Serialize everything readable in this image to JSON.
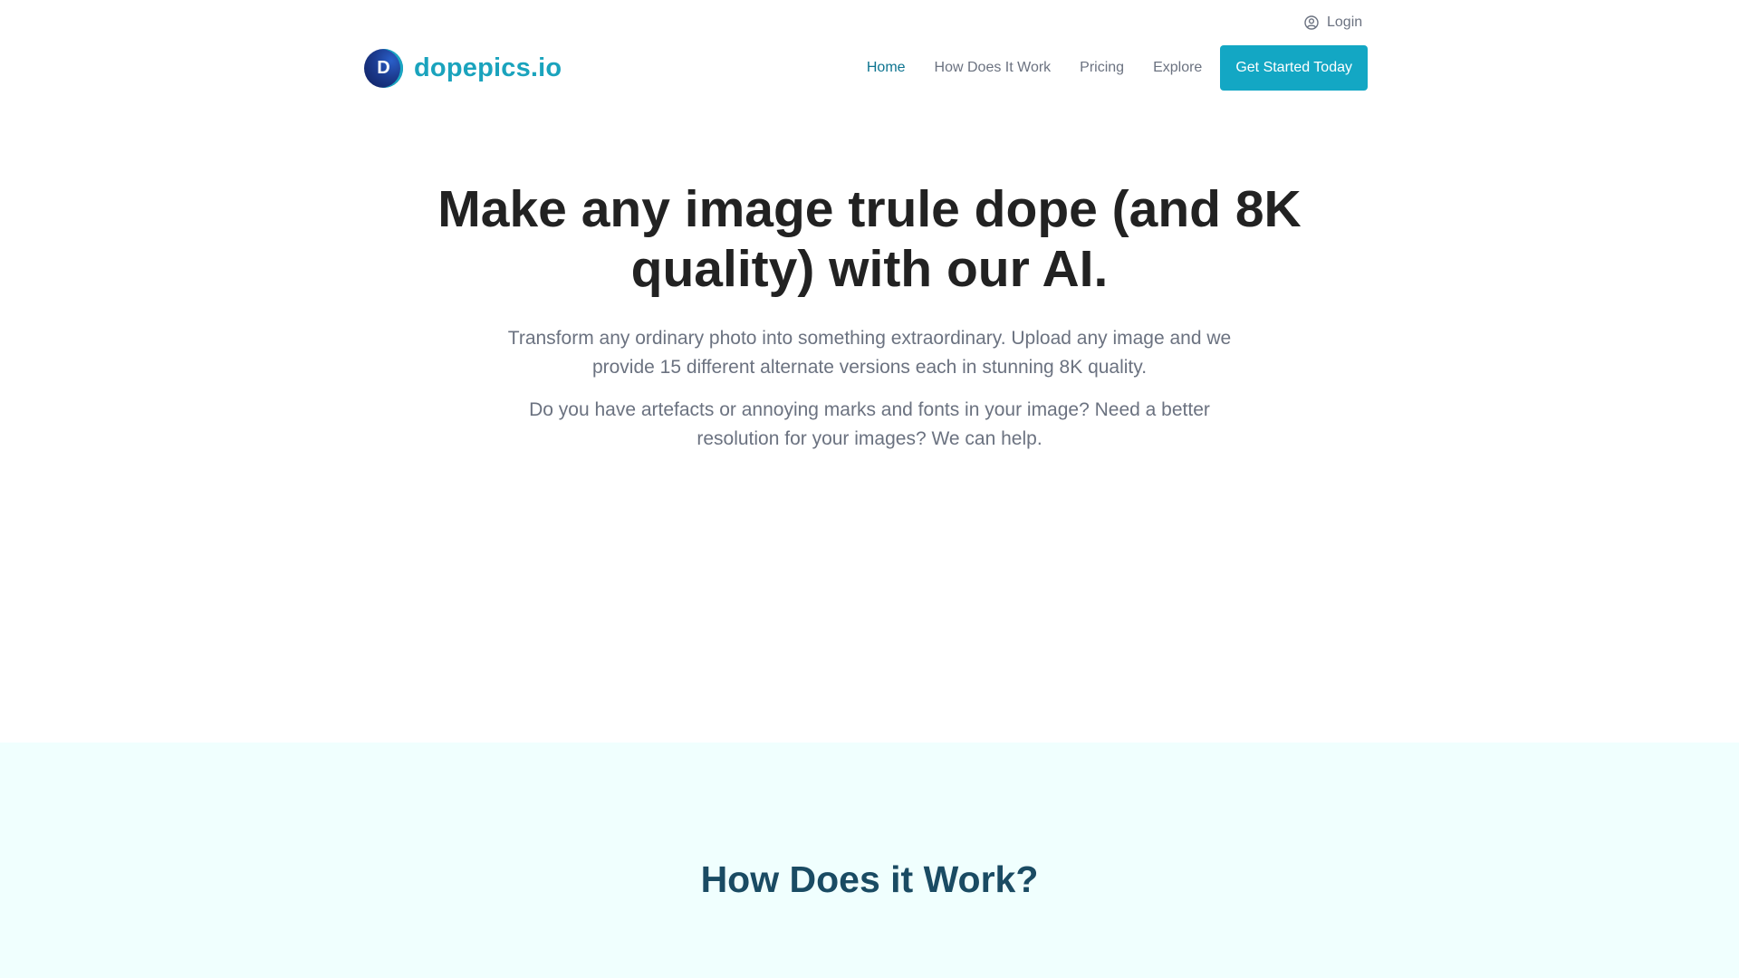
{
  "top_bar": {
    "login_label": "Login",
    "login_icon": "user-circle-icon"
  },
  "header": {
    "logo_letter": "D",
    "brand_name": "dopepics.io",
    "nav": {
      "home": "Home",
      "how": "How Does It Work",
      "pricing": "Pricing",
      "explore": "Explore",
      "cta": "Get Started Today"
    }
  },
  "hero": {
    "title": "Make any image trule dope (and 8K quality) with our AI.",
    "paragraph1": "Transform any ordinary photo into something extraordinary. Upload any image and we provide 15 different alternate versions each in stunning 8K quality.",
    "paragraph2": "Do you have artefacts or annoying marks and fonts in your image? Need a better resolution for your images? We can help."
  },
  "how_section": {
    "title": "How Does it Work?"
  },
  "colors": {
    "brand": "#1aa3bd",
    "cta_bg": "#13a7c4",
    "nav_active": "#0e7490",
    "heading": "#222222",
    "body_text": "#6b7280",
    "section_bg": "#f0fffe",
    "section_title": "#1a4b63"
  }
}
